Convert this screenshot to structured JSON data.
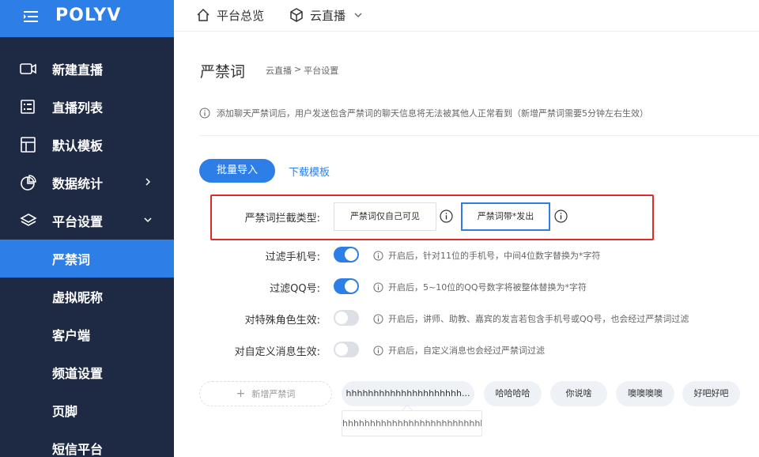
{
  "brand": {
    "logo_text": "POLYV",
    "accent_color": "#2d7ee6",
    "sidebar_bg": "#1e2a44"
  },
  "topbar": {
    "home_label": "平台总览",
    "live_label": "云直播"
  },
  "sidebar": {
    "items": [
      {
        "label": "新建直播",
        "icon": "video-camera-icon"
      },
      {
        "label": "直播列表",
        "icon": "list-icon"
      },
      {
        "label": "默认模板",
        "icon": "template-layout-icon"
      },
      {
        "label": "数据统计",
        "icon": "pie-chart-icon"
      },
      {
        "label": "平台设置",
        "icon": "layers-icon"
      }
    ],
    "sub_items": [
      {
        "label": "严禁词",
        "active": true
      },
      {
        "label": "虚拟昵称"
      },
      {
        "label": "客户端"
      },
      {
        "label": "频道设置"
      },
      {
        "label": "页脚"
      },
      {
        "label": "短信平台"
      }
    ]
  },
  "page": {
    "title": "严禁词",
    "breadcrumb": [
      "云直播",
      ">",
      "平台设置"
    ],
    "notice": "添加聊天严禁词后，用户发送包含严禁词的聊天信息将无法被其他人正常看到（新增严禁词需要5分钟左右生效）",
    "import_button": "批量导入",
    "download_template": "下载模板",
    "intercept_label": "严禁词拦截类型:",
    "intercept_option_a": "严禁词仅自己可见",
    "intercept_option_b": "严禁词带*发出",
    "rows": [
      {
        "label": "过滤手机号:",
        "enabled": true,
        "tip": "开启后，针对11位的手机号，中间4位数字替换为*字符"
      },
      {
        "label": "过滤QQ号:",
        "enabled": true,
        "tip": "开启后，5~10位的QQ号数字将被整体替换为*字符"
      },
      {
        "label": "对特殊角色生效:",
        "enabled": false,
        "tip": "开启后，讲师、助教、嘉宾的发言若包含手机号或QQ号，也会经过严禁词过滤"
      },
      {
        "label": "对自定义消息生效:",
        "enabled": false,
        "tip": "开启后，自定义消息也会经过严禁词过滤"
      }
    ],
    "add_word_label": "新增严禁词",
    "tags": [
      "hhhhhhhhhhhhhhhhhhhhh...",
      "哈哈哈哈",
      "你说啥",
      "噢噢噢噢",
      "好吧好吧"
    ],
    "tooltip_text": "hhhhhhhhhhhhhhhhhhhhhhhhhh"
  }
}
